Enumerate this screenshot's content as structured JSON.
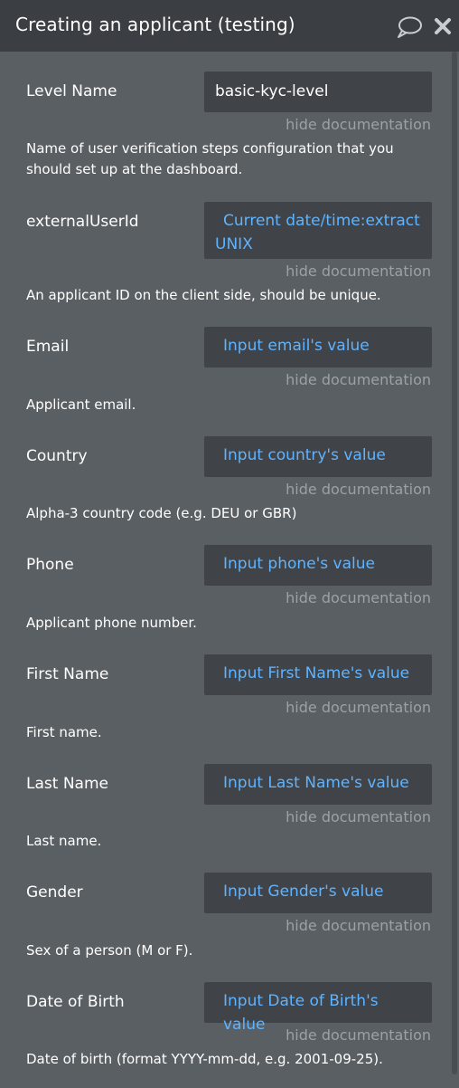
{
  "window": {
    "title": "Creating an applicant (testing)"
  },
  "fields": [
    {
      "label": "Level Name",
      "value": "basic-kyc-level",
      "is_dynamic": false,
      "hide_link": "hide documentation",
      "doc": "Name of user verification steps configuration that you should set up at the dashboard."
    },
    {
      "label": "externalUserId",
      "value": "Current date/time:extract UNIX",
      "is_dynamic": true,
      "hide_link": "hide documentation",
      "doc": "An applicant ID on the client side, should be unique."
    },
    {
      "label": "Email",
      "value": "Input email's value",
      "is_dynamic": true,
      "hide_link": "hide documentation",
      "doc": "Applicant email."
    },
    {
      "label": "Country",
      "value": "Input country's value",
      "is_dynamic": true,
      "hide_link": "hide documentation",
      "doc": "Alpha-3 country code (e.g. DEU or GBR)"
    },
    {
      "label": "Phone",
      "value": "Input phone's value",
      "is_dynamic": true,
      "hide_link": "hide documentation",
      "doc": "Applicant phone number."
    },
    {
      "label": "First Name",
      "value": "Input First Name's value",
      "is_dynamic": true,
      "hide_link": "hide documentation",
      "doc": "First name."
    },
    {
      "label": "Last Name",
      "value": "Input Last Name's value",
      "is_dynamic": true,
      "hide_link": "hide documentation",
      "doc": "Last name."
    },
    {
      "label": "Gender",
      "value": "Input Gender's value",
      "is_dynamic": true,
      "hide_link": "hide documentation",
      "doc": "Sex of a person (M or F)."
    },
    {
      "label": "Date of Birth",
      "value": "Input Date of Birth's value",
      "is_dynamic": true,
      "hide_link": "hide documentation",
      "doc": "Date of birth (format YYYY-mm-dd, e.g. 2001-09-25)."
    }
  ],
  "colors": {
    "panel_bg": "#5a5f63",
    "titlebar_bg": "#3b3f43",
    "input_bg": "#404448",
    "dynamic_text": "#5fb3ff",
    "muted_text": "#9ca1a6"
  },
  "icons": {
    "comment": "speech-bubble-icon",
    "close": "close-icon"
  }
}
